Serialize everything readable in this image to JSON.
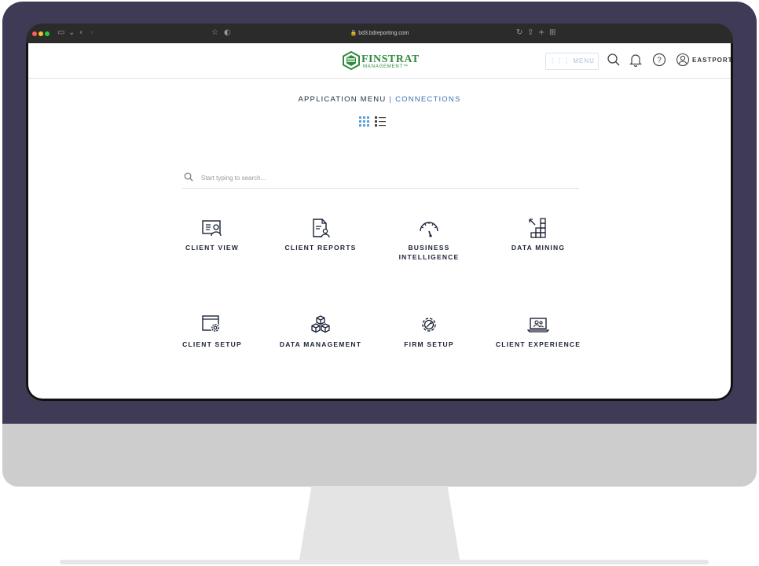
{
  "browser": {
    "url": "bd3.bdreporting.com"
  },
  "header": {
    "logo_word": "FINSTRAT",
    "logo_sub": "MANAGEMENT™",
    "menu_label": "MENU",
    "user_label": "EASTPORT"
  },
  "subnav": {
    "primary": "APPLICATION MENU",
    "separator": "|",
    "secondary": "CONNECTIONS"
  },
  "search": {
    "placeholder": "Start typing to search..."
  },
  "tiles": [
    {
      "label": "CLIENT VIEW",
      "icon": "client-view-icon"
    },
    {
      "label": "CLIENT REPORTS",
      "icon": "client-reports-icon"
    },
    {
      "label": "BUSINESS INTELLIGENCE",
      "icon": "gauge-icon"
    },
    {
      "label": "DATA MINING",
      "icon": "data-mining-icon"
    },
    {
      "label": "CLIENT SETUP",
      "icon": "client-setup-icon"
    },
    {
      "label": "DATA MANAGEMENT",
      "icon": "cubes-icon"
    },
    {
      "label": "FIRM SETUP",
      "icon": "firm-setup-icon"
    },
    {
      "label": "CLIENT EXPERIENCE",
      "icon": "laptop-user-icon"
    }
  ],
  "colors": {
    "bezel": "#3f3a55",
    "brand_green": "#2e8b3e",
    "link_blue": "#3c6fb0",
    "grid_toggle_blue": "#5aa0d8"
  }
}
